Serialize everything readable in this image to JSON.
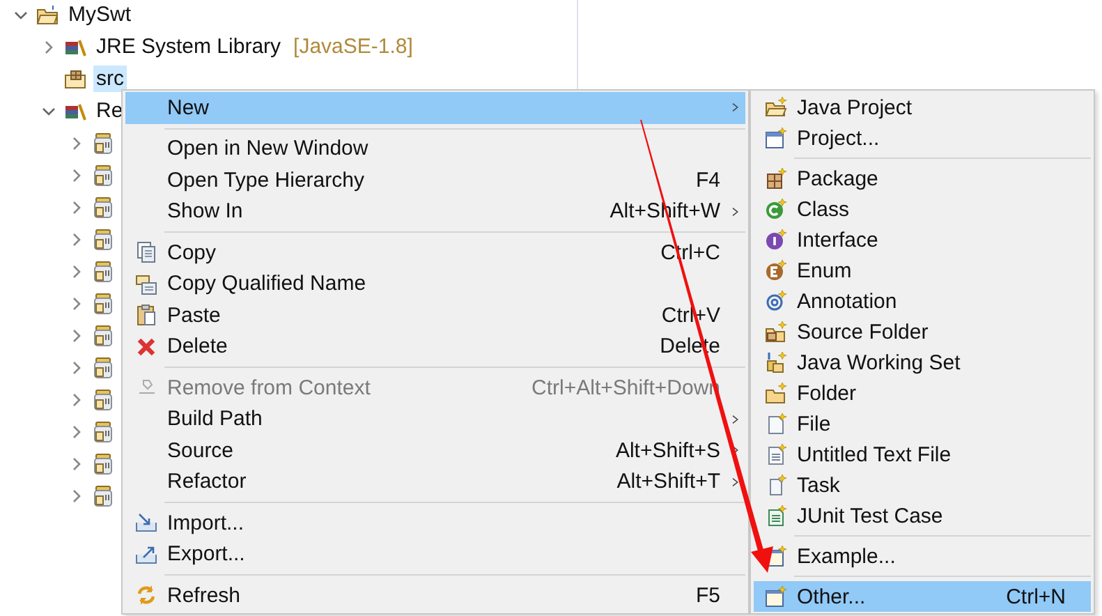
{
  "tree": [
    {
      "label": "MySwt",
      "expanded": true,
      "selected": false,
      "children": [
        {
          "label": "JRE System Library",
          "note": "[JavaSE-1.8]",
          "expanded": false,
          "selected": false
        },
        {
          "label": "src",
          "selected": true
        },
        {
          "label": "Re",
          "expanded": true,
          "selected": false,
          "children": [
            {
              "kind": "jar",
              "expanded": false
            },
            {
              "kind": "jar",
              "expanded": false
            },
            {
              "kind": "jar",
              "expanded": false
            },
            {
              "kind": "jar",
              "expanded": false
            },
            {
              "kind": "jar",
              "expanded": false
            },
            {
              "kind": "jar",
              "expanded": false
            },
            {
              "kind": "jar",
              "expanded": false
            },
            {
              "kind": "jar",
              "expanded": false
            },
            {
              "kind": "jar",
              "expanded": false
            },
            {
              "kind": "jar",
              "expanded": false
            },
            {
              "kind": "jar",
              "expanded": false
            },
            {
              "kind": "jar",
              "expanded": false
            }
          ]
        }
      ]
    }
  ],
  "context_menu": {
    "sections": [
      [
        {
          "label": "New",
          "submenu": true,
          "selected": true,
          "disabled": false
        }
      ],
      [
        {
          "label": "Open in New Window",
          "selected": false,
          "disabled": false
        },
        {
          "label": "Open Type Hierarchy",
          "shortcut": "F4",
          "selected": false,
          "disabled": false
        },
        {
          "label": "Show In",
          "shortcut": "Alt+Shift+W",
          "submenu": true,
          "selected": false,
          "disabled": false
        }
      ],
      [
        {
          "label": "Copy",
          "shortcut": "Ctrl+C",
          "selected": false,
          "disabled": false
        },
        {
          "label": "Copy Qualified Name",
          "selected": false,
          "disabled": false
        },
        {
          "label": "Paste",
          "shortcut": "Ctrl+V",
          "selected": false,
          "disabled": false
        },
        {
          "label": "Delete",
          "shortcut": "Delete",
          "selected": false,
          "disabled": false
        }
      ],
      [
        {
          "label": "Remove from Context",
          "shortcut": "Ctrl+Alt+Shift+Down",
          "selected": false,
          "disabled": true
        },
        {
          "label": "Build Path",
          "submenu": true,
          "selected": false,
          "disabled": false
        },
        {
          "label": "Source",
          "shortcut": "Alt+Shift+S",
          "submenu": true,
          "selected": false,
          "disabled": false
        },
        {
          "label": "Refactor",
          "shortcut": "Alt+Shift+T",
          "submenu": true,
          "selected": false,
          "disabled": false
        }
      ],
      [
        {
          "label": "Import...",
          "selected": false,
          "disabled": false
        },
        {
          "label": "Export...",
          "selected": false,
          "disabled": false
        }
      ],
      [
        {
          "label": "Refresh",
          "shortcut": "F5",
          "selected": false,
          "disabled": false
        }
      ]
    ]
  },
  "new_submenu": {
    "sections": [
      [
        {
          "label": "Java Project",
          "selected": false
        },
        {
          "label": "Project...",
          "selected": false
        }
      ],
      [
        {
          "label": "Package",
          "selected": false
        },
        {
          "label": "Class",
          "selected": false
        },
        {
          "label": "Interface",
          "selected": false
        },
        {
          "label": "Enum",
          "selected": false
        },
        {
          "label": "Annotation",
          "selected": false
        },
        {
          "label": "Source Folder",
          "selected": false
        },
        {
          "label": "Java Working Set",
          "selected": false
        },
        {
          "label": "Folder",
          "selected": false
        },
        {
          "label": "File",
          "selected": false
        },
        {
          "label": "Untitled Text File",
          "selected": false
        },
        {
          "label": "Task",
          "selected": false
        },
        {
          "label": "JUnit Test Case",
          "selected": false
        }
      ],
      [
        {
          "label": "Example...",
          "selected": false
        }
      ],
      [
        {
          "label": "Other...",
          "shortcut": "Ctrl+N",
          "selected": true
        }
      ]
    ]
  }
}
